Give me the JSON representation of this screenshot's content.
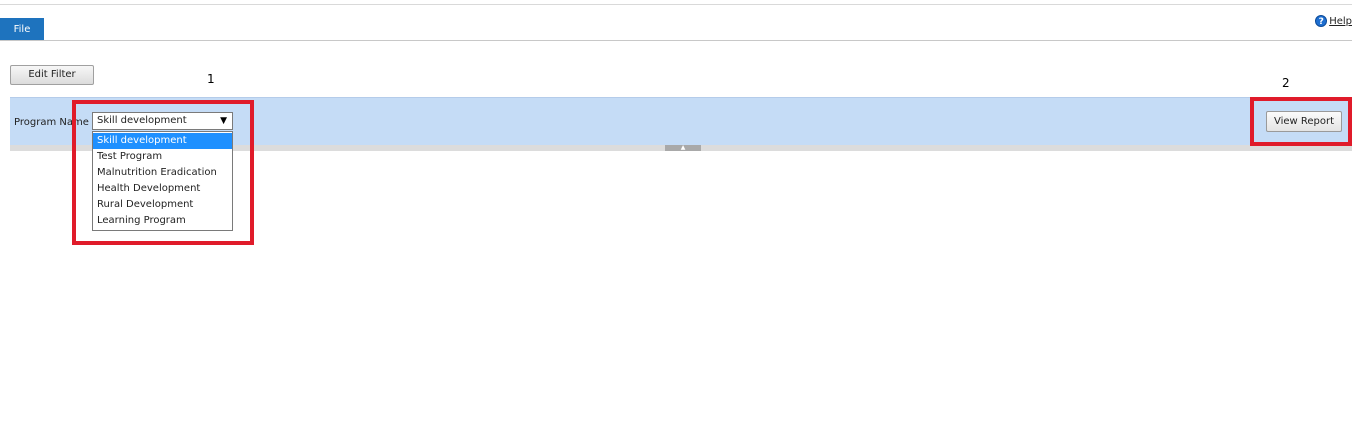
{
  "toolbar": {
    "file_tab": "File",
    "help_label": "Help",
    "help_icon": "?"
  },
  "filter": {
    "edit_filter_label": "Edit Filter"
  },
  "annotations": {
    "first": "1",
    "second": "2"
  },
  "parameters": {
    "program_label": "Program Name",
    "program_selected": "Skill development",
    "dropdown_arrow": "▼",
    "options": [
      "Skill development",
      "Test Program",
      "Malnutrition Eradication",
      "Health Development",
      "Rural Development",
      "Learning Program"
    ],
    "view_report_label": "View Report"
  },
  "colors": {
    "accent": "#1e73be",
    "param_band": "#c5dcf6",
    "highlight_box": "#e01b2a",
    "selected_option": "#1e90ff"
  }
}
